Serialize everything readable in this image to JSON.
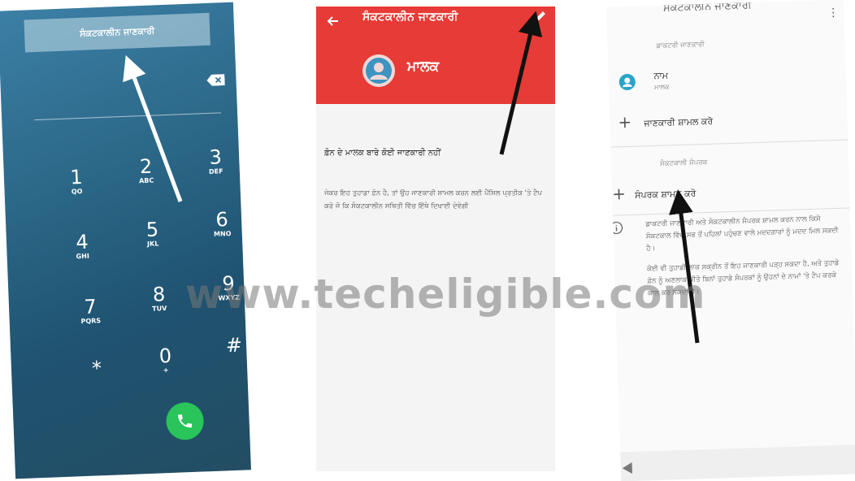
{
  "dialer": {
    "emergency_label": "ਸੰਕਟਕਾਲੀਨ ਜਾਣਕਾਰੀ",
    "keys": [
      {
        "digit": "1",
        "letters": "QO"
      },
      {
        "digit": "2",
        "letters": "ABC"
      },
      {
        "digit": "3",
        "letters": "DEF"
      },
      {
        "digit": "4",
        "letters": "GHI"
      },
      {
        "digit": "5",
        "letters": "JKL"
      },
      {
        "digit": "6",
        "letters": "MNO"
      },
      {
        "digit": "7",
        "letters": "PQRS"
      },
      {
        "digit": "8",
        "letters": "TUV"
      },
      {
        "digit": "9",
        "letters": "WXYZ"
      },
      {
        "digit": "*",
        "letters": ""
      },
      {
        "digit": "0",
        "letters": "+"
      },
      {
        "digit": "#",
        "letters": ""
      }
    ]
  },
  "emergency_screen": {
    "title": "ਸੰਕਟਕਾਲੀਨ ਜਾਣਕਾਰੀ",
    "owner_label": "ਮਾਲਕ",
    "no_info": "ਫ਼ੋਨ ਦੇ ਮਾਲਕ ਬਾਰੇ ਕੋਈ ਜਾਣਕਾਰੀ ਨਹੀਂ",
    "hint": "ਜੇਕਰ ਇਹ ਤੁਹਾਡਾ ਫ਼ੋਨ ਹੈ, ਤਾਂ ਉਹ ਜਾਣਕਾਰੀ ਸ਼ਾਮਲ ਕਰਨ ਲਈ ਪੈਂਸਿਲ ਪ੍ਰਤੀਕ 'ਤੇ ਟੈਪ ਕਰੋ ਜੋ ਕਿ ਸੰਕਟਕਾਲੀਨ ਸਥਿਤੀ ਵਿੱਚ ਇੱਥੇ ਦਿਖਾਈ ਦੇਵੇਗੀ"
  },
  "settings_screen": {
    "title": "ਸੰਕਟਕਾਲੀਨ ਜਾਣਕਾਰੀ",
    "medical_section": "ਡਾਕਟਰੀ ਜਾਣਕਾਰੀ",
    "name_label": "ਨਾਮ",
    "name_sub": "ਮਾਲਕ",
    "add_info": "ਜਾਣਕਾਰੀ ਸ਼ਾਮਲ ਕਰੋ",
    "contacts_section": "ਸੰਕਟਕਾਲੀ ਸੰਪਰਕ",
    "add_contact": "ਸੰਪਰਕ ਸ਼ਾਮਲ ਕਰੋ",
    "info_text_1": "ਡਾਕਟਰੀ ਜਾਣਕਾਰੀ ਅਤੇ ਸੰਕਟਕਾਲੀਨ ਸੰਪਰਕ ਸ਼ਾਮਲ ਕਰਨ ਨਾਲ ਕਿਸੇ ਸੰਕਟਕਾਲ ਵਿੱਚ ਸਭ ਤੋਂ ਪਹਿਲਾਂ ਪਹੁੰਚਣ ਵਾਲੇ ਮਦਦਗਾਰਾਂ ਨੂੰ ਮਦਦ ਮਿਲ ਸਕਦੀ ਹੈ।",
    "info_text_2": "ਕੋਈ ਵੀ ਤੁਹਾਡੀ ਲਾਕ ਸਕ੍ਰੀਨ ਤੋਂ ਇਹ ਜਾਣਕਾਰੀ ਪੜ੍ਹ ਸਕਦਾ ਹੈ, ਅਤੇ ਤੁਹਾਡੇ ਫ਼ੋਨ ਨੂੰ ਅਣਲਾਕ ਕੀਤੇ ਬਿਨਾਂ ਤੁਹਾਡੇ ਸੰਪਰਕਾਂ ਨੂੰ ਉਹਨਾਂ ਦੇ ਨਾਮਾਂ 'ਤੇ ਟੈਪ ਕਰਕੇ ਕਾਲ ਕਰ ਸਕਦਾ ਹੈ।"
  },
  "watermark": "www.techeligible.com"
}
